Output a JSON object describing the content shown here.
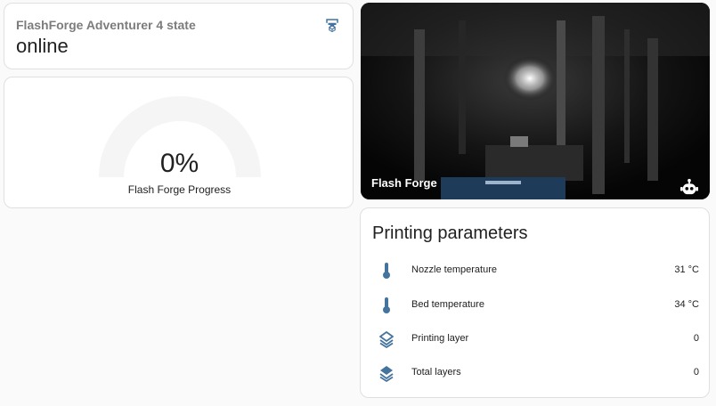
{
  "state_card": {
    "title": "FlashForge Adventurer 4 state",
    "value": "online",
    "icon": "printer-3d-icon"
  },
  "progress_gauge": {
    "value_text": "0%",
    "value": 0,
    "name": "Flash Forge Progress"
  },
  "camera": {
    "name": "Flash Forge",
    "icon": "robot-icon"
  },
  "parameters": {
    "heading": "Printing parameters",
    "rows": [
      {
        "label": "Nozzle temperature",
        "value": "31 °C",
        "icon": "thermometer-icon"
      },
      {
        "label": "Bed temperature",
        "value": "34 °C",
        "icon": "thermometer-icon"
      },
      {
        "label": "Printing layer",
        "value": "0",
        "icon": "layers-outline-icon"
      },
      {
        "label": "Total layers",
        "value": "0",
        "icon": "layers-icon"
      }
    ]
  },
  "colors": {
    "icon_blue": "#44739e",
    "gauge_track": "#f5f5f5"
  }
}
